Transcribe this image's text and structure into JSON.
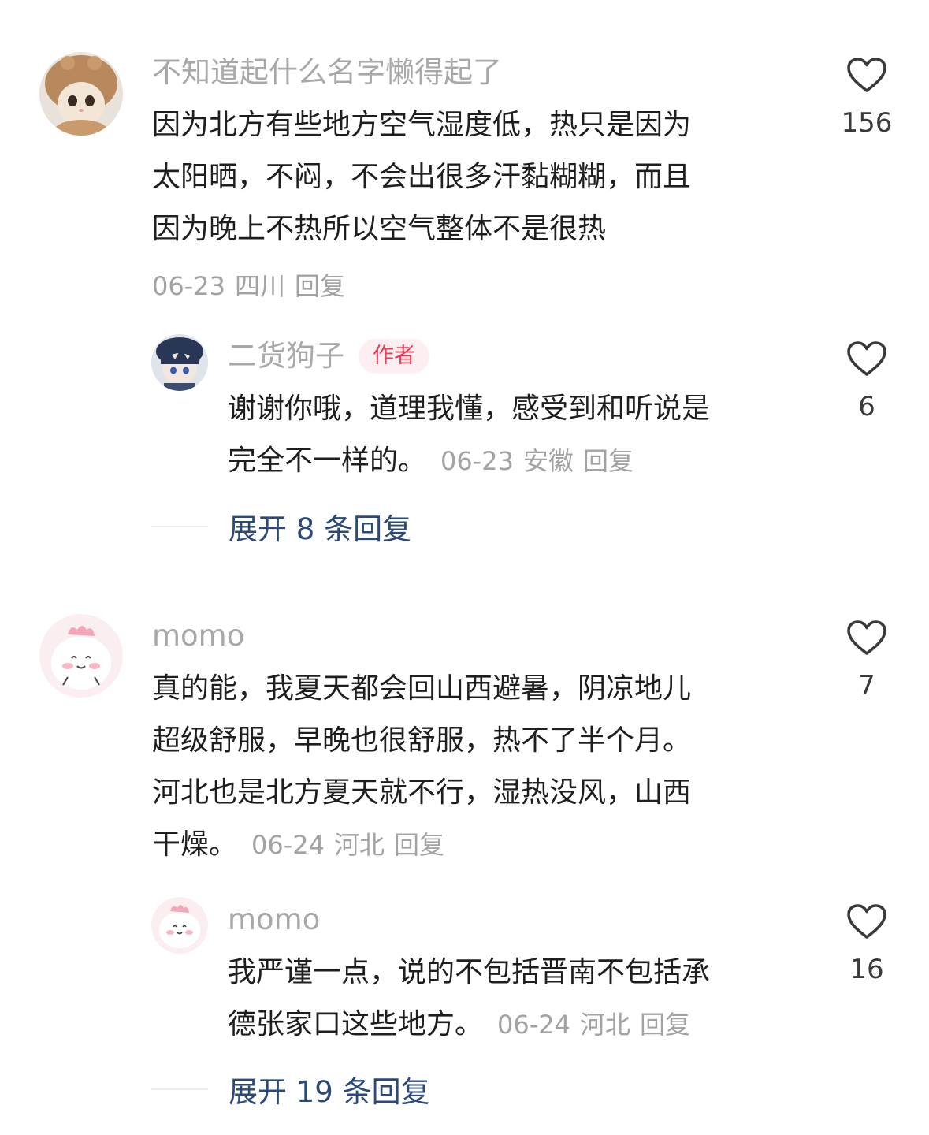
{
  "comments": [
    {
      "username": "不知道起什么名字懒得起了",
      "lines": [
        "因为北方有些地方空气湿度低，热只是因为",
        "太阳晒，不闷，不会出很多汗黏糊糊，而且",
        "因为晚上不热所以空气整体不是很热"
      ],
      "date": "06-23",
      "location": "四川",
      "reply_label": "回复",
      "likes": "156",
      "avatar_icon": "cat-avatar-icon"
    },
    {
      "username": "二货狗子",
      "badge": "作者",
      "lines": [
        "谢谢你哦，道理我懂，感受到和听说是",
        "完全不一样的。"
      ],
      "date": "06-23",
      "location": "安徽",
      "reply_label": "回复",
      "likes": "6",
      "avatar_icon": "doll-avatar-icon"
    },
    {
      "username": "momo",
      "lines": [
        "真的能，我夏天都会回山西避暑，阴凉地儿",
        "超级舒服，早晚也很舒服，热不了半个月。",
        "河北也是北方夏天就不行，湿热没风，山西",
        "干燥。"
      ],
      "date": "06-24",
      "location": "河北",
      "reply_label": "回复",
      "likes": "7",
      "avatar_icon": "pink-creature-avatar-icon"
    },
    {
      "username": "momo",
      "lines": [
        "我严谨一点，说的不包括晋南不包括承",
        "德张家口这些地方。"
      ],
      "date": "06-24",
      "location": "河北",
      "reply_label": "回复",
      "likes": "16",
      "avatar_icon": "pink-creature-avatar-icon"
    }
  ],
  "expand_replies": [
    {
      "label": "展开 8 条回复"
    },
    {
      "label": "展开 19 条回复"
    }
  ],
  "colors": {
    "username": "#a8a8a8",
    "text": "#1e1e1e",
    "meta": "#a3a3a3",
    "author_badge_bg": "#fdeff1",
    "author_badge_text": "#ea3b55",
    "expand_link": "#2b4a7a"
  },
  "icons": {
    "like": "heart-outline-icon"
  }
}
